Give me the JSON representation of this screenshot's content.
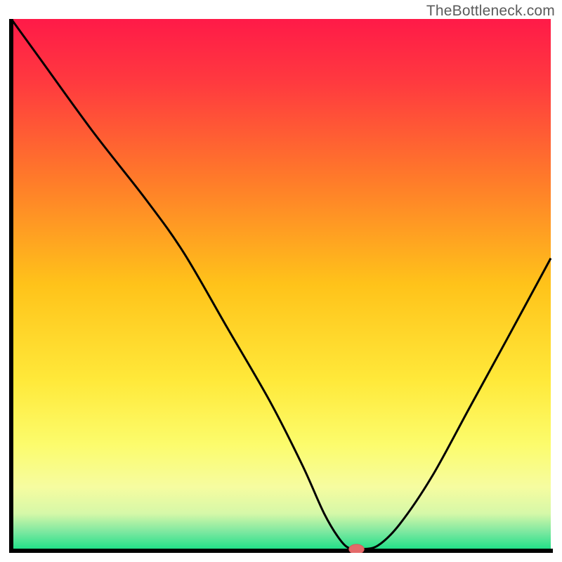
{
  "watermark": "TheBottleneck.com",
  "colors": {
    "axis": "#000000",
    "curve": "#000000",
    "marker_fill": "#e46a6a",
    "marker_stroke": "#d85a5a",
    "gradient_stops": [
      {
        "offset": 0.0,
        "color": "#ff1a48"
      },
      {
        "offset": 0.12,
        "color": "#ff3a3f"
      },
      {
        "offset": 0.3,
        "color": "#ff7a2a"
      },
      {
        "offset": 0.5,
        "color": "#ffc31a"
      },
      {
        "offset": 0.68,
        "color": "#ffe93a"
      },
      {
        "offset": 0.8,
        "color": "#fcfc6c"
      },
      {
        "offset": 0.88,
        "color": "#f6fca0"
      },
      {
        "offset": 0.93,
        "color": "#d6f8a8"
      },
      {
        "offset": 0.965,
        "color": "#7be8a0"
      },
      {
        "offset": 1.0,
        "color": "#18df86"
      }
    ]
  },
  "plot": {
    "inner_width": 774,
    "inner_height": 760,
    "x_range": [
      0,
      1
    ],
    "y_range": [
      0,
      1
    ]
  },
  "chart_data": {
    "type": "line",
    "title": "",
    "xlabel": "",
    "ylabel": "",
    "xlim": [
      0,
      1
    ],
    "ylim": [
      0,
      1
    ],
    "x": [
      0.0,
      0.05,
      0.15,
      0.25,
      0.32,
      0.4,
      0.48,
      0.54,
      0.58,
      0.61,
      0.63,
      0.65,
      0.68,
      0.72,
      0.78,
      0.85,
      0.92,
      1.0
    ],
    "values": [
      1.0,
      0.93,
      0.79,
      0.66,
      0.56,
      0.42,
      0.28,
      0.16,
      0.07,
      0.02,
      0.003,
      0.003,
      0.01,
      0.05,
      0.14,
      0.27,
      0.4,
      0.55
    ],
    "series": [
      {
        "name": "curve",
        "color": "#000000"
      }
    ],
    "marker": {
      "x": 0.64,
      "y": 0.003,
      "rx": 0.014,
      "ry": 0.009
    },
    "annotations": []
  }
}
